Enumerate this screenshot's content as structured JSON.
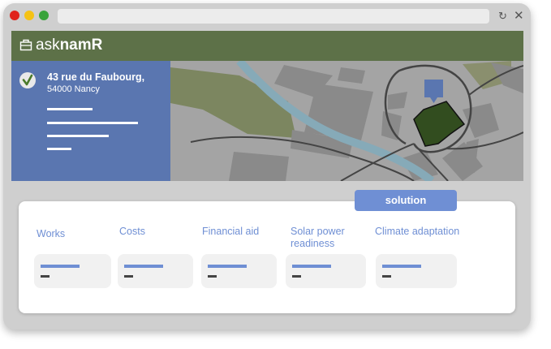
{
  "window": {
    "traffic_lights": {
      "close": "#e0231c",
      "minimize": "#f5c214",
      "maximize": "#39a33a"
    },
    "icons": [
      "refresh-icon",
      "close-icon"
    ]
  },
  "colors": {
    "header": "#5d7148",
    "sidebar": "#5a76b0",
    "accent": "#6f8fd4",
    "map_bg": "#a4a4a4",
    "river": "#86aab8",
    "park": "#7c8660",
    "selected_parcel": "#324d1f"
  },
  "app": {
    "logo_prefix": "ask",
    "logo_suffix": "namR"
  },
  "address": {
    "line1": "43 rue du Faubourg,",
    "line2": "54000 Nancy"
  },
  "solution_tab": "solution",
  "tabs": [
    {
      "label": "Works"
    },
    {
      "label": "Costs"
    },
    {
      "label": "Financial aid"
    },
    {
      "label": "Solar power readiness"
    },
    {
      "label": "Climate adaptation"
    }
  ]
}
